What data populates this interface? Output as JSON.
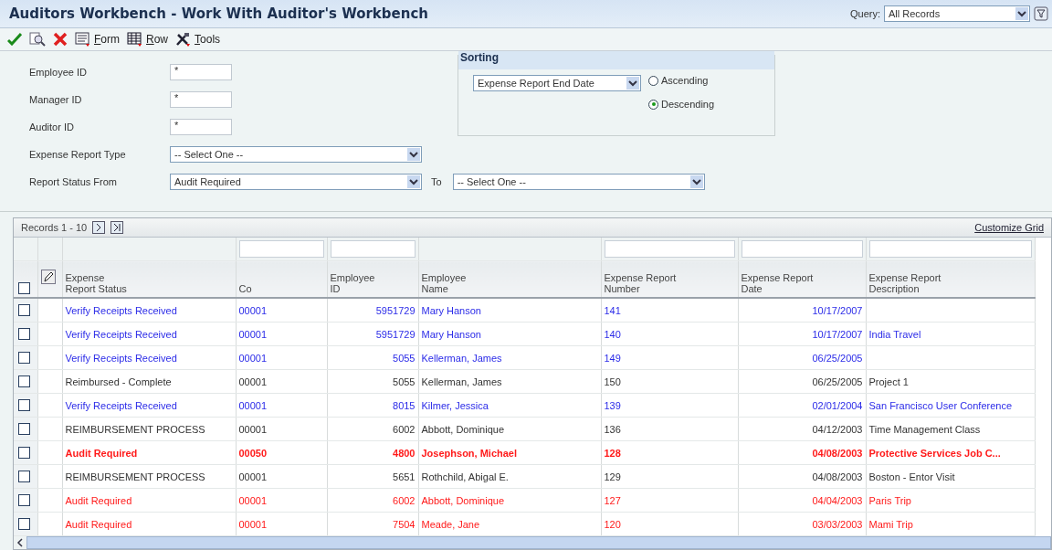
{
  "window": {
    "title": "Auditors Workbench - Work With Auditor's Workbench"
  },
  "query": {
    "label": "Query:",
    "value": "All Records"
  },
  "toolbar": [
    {
      "label": "Form",
      "kind": "form"
    },
    {
      "label": "Row",
      "kind": "row"
    },
    {
      "label": "Tools",
      "kind": "tools"
    }
  ],
  "filters": [
    {
      "kind": "text",
      "label": "Employee ID",
      "value": "*"
    },
    {
      "kind": "text",
      "label": "Manager ID",
      "value": "*"
    },
    {
      "kind": "text",
      "label": "Auditor ID",
      "value": "*"
    },
    {
      "kind": "select",
      "label": "Expense Report Type",
      "value": "-- Select One --"
    },
    {
      "kind": "range",
      "label": "Report Status From",
      "value": "Audit Required",
      "to_label": "To",
      "to_value": "-- Select One --"
    }
  ],
  "sorting": {
    "title": "Sorting",
    "field": "Expense Report End Date",
    "options": [
      {
        "label": "Ascending",
        "selected": false
      },
      {
        "label": "Descending",
        "selected": true
      }
    ]
  },
  "grid": {
    "select_all_checked": false,
    "records_label": "Records",
    "range": "1 - 10",
    "customize": "Customize Grid",
    "columns": [
      {
        "lines": [
          "Expense",
          "Report Status"
        ],
        "filter": false,
        "kind": "text"
      },
      {
        "lines": [
          "Co"
        ],
        "filter": true,
        "kind": "text"
      },
      {
        "lines": [
          "Employee",
          "ID"
        ],
        "filter": true,
        "kind": "number"
      },
      {
        "lines": [
          "Employee",
          "Name"
        ],
        "filter": false,
        "kind": "text"
      },
      {
        "lines": [
          "Expense Report",
          "Number"
        ],
        "filter": true,
        "kind": "text"
      },
      {
        "lines": [
          "Expense Report",
          "Date"
        ],
        "filter": true,
        "kind": "number"
      },
      {
        "lines": [
          "Expense Report",
          "Description"
        ],
        "filter": true,
        "kind": "text"
      }
    ],
    "rows": [
      {
        "checked": false,
        "color": "#2b2be8",
        "emphasized": false,
        "cells": [
          "Verify Receipts Received",
          "00001",
          "5951729",
          "Mary Hanson",
          "141",
          "10/17/2007",
          ""
        ]
      },
      {
        "checked": false,
        "color": "#2b2be8",
        "emphasized": false,
        "cells": [
          "Verify Receipts Received",
          "00001",
          "5951729",
          "Mary Hanson",
          "140",
          "10/17/2007",
          "India Travel"
        ]
      },
      {
        "checked": false,
        "color": "#2b2be8",
        "emphasized": false,
        "cells": [
          "Verify Receipts Received",
          "00001",
          "5055",
          "Kellerman, James",
          "149",
          "06/25/2005",
          ""
        ]
      },
      {
        "checked": false,
        "color": "#333333",
        "emphasized": false,
        "cells": [
          "Reimbursed - Complete",
          "00001",
          "5055",
          "Kellerman, James",
          "150",
          "06/25/2005",
          "Project 1"
        ]
      },
      {
        "checked": false,
        "color": "#2b2be8",
        "emphasized": false,
        "cells": [
          "Verify Receipts Received",
          "00001",
          "8015",
          "Kilmer, Jessica",
          "139",
          "02/01/2004",
          "San Francisco User Conference"
        ]
      },
      {
        "checked": false,
        "color": "#333333",
        "emphasized": false,
        "cells": [
          "REIMBURSEMENT PROCESS",
          "00001",
          "6002",
          "Abbott, Dominique",
          "136",
          "04/12/2003",
          "Time Management Class"
        ]
      },
      {
        "checked": false,
        "color": "#ff1a1a",
        "emphasized": true,
        "cells": [
          "Audit Required",
          "00050",
          "4800",
          "Josephson, Michael",
          "128",
          "04/08/2003",
          "Protective Services Job C..."
        ]
      },
      {
        "checked": false,
        "color": "#333333",
        "emphasized": false,
        "cells": [
          "REIMBURSEMENT PROCESS",
          "00001",
          "5651",
          "Rothchild, Abigal E.",
          "129",
          "04/08/2003",
          "Boston - Entor Visit"
        ]
      },
      {
        "checked": false,
        "color": "#ff1a1a",
        "emphasized": false,
        "cells": [
          "Audit Required",
          "00001",
          "6002",
          "Abbott, Dominique",
          "127",
          "04/04/2003",
          "Paris Trip"
        ]
      },
      {
        "checked": false,
        "color": "#ff1a1a",
        "emphasized": false,
        "cells": [
          "Audit Required",
          "00001",
          "7504",
          "Meade, Jane",
          "120",
          "03/03/2003",
          "Mami Trip"
        ]
      }
    ]
  }
}
